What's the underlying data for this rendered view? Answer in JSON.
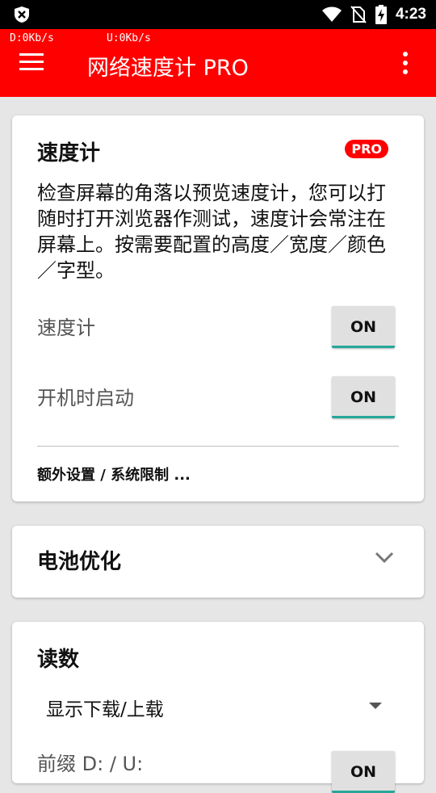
{
  "status_bar": {
    "time": "4:23",
    "icons": [
      "shield-x-icon",
      "wifi-icon",
      "no-sim-icon",
      "battery-charging-icon"
    ]
  },
  "app_bar": {
    "speed_down": "D:0Kb/s",
    "speed_up": "U:0Kb/s",
    "title": "网络速度计 PRO",
    "bg_color": "#ff0000"
  },
  "speedometer_card": {
    "title": "速度计",
    "badge": "PRO",
    "description": "检查屏幕的角落以预览速度计，您可以打随时打开浏览器作测试，速度计会常注在屏幕上。按需要配置的高度／宽度／颜色／字型。",
    "settings": [
      {
        "label": "速度计",
        "toggle": "ON"
      },
      {
        "label": "开机时启动",
        "toggle": "ON"
      }
    ],
    "extra_link": "额外设置 / 系统限制 ..."
  },
  "battery_card": {
    "title": "电池优化"
  },
  "readings_card": {
    "title": "读数",
    "dropdown_value": "显示下载/上载",
    "prefix_label": "前缀 D: / U:",
    "prefix_toggle": "ON"
  },
  "colors": {
    "accent": "#26a69a",
    "toggle_bg": "#e0e0e0"
  }
}
